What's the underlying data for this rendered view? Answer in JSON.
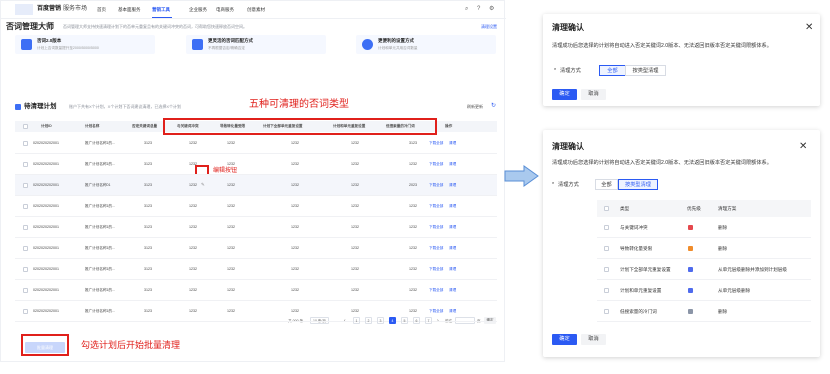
{
  "header": {
    "brand": "百度营销",
    "brand_sub": "服务市场",
    "nav": [
      "首页",
      "基本面服务",
      "营销工具",
      "企业服务",
      "电商服务",
      "创意素材"
    ],
    "active_nav": "营销工具"
  },
  "page": {
    "title": "否词管理大师",
    "subtitle": "否词管理大师支持快速清理计划下的否单元重复且有的关键词冲突的否词，可帮助您快速释放否词空间。",
    "help_link": "清理设置",
    "cards": [
      {
        "title": "否词2.0版本",
        "desc": "计划上否词数量提升至2000/5000/5000"
      },
      {
        "title": "更灵活的否词匹配方式",
        "desc": "不再根据否定/精确否定"
      },
      {
        "title": "更便利的设置方式",
        "desc": "计划和单元共用否词数量"
      }
    ]
  },
  "plans": {
    "title": "待清理计划",
    "summary": "账户下共有X个计划，X个计划下否词建议清理，已选择X个计划",
    "refresh": "刷新更新",
    "columns": [
      "计划ID",
      "计划名称",
      "否定关键词总量",
      "与关键词冲突",
      "导致转化量受限",
      "计划下全部单元重复设置",
      "计划和单元重复设置",
      "低搜索量的冷门词",
      "操作"
    ],
    "rows": [
      {
        "id": "0202020202001",
        "name": "推广计划名称1的...",
        "total": "3123",
        "c1": "1232",
        "c2": "1232",
        "c3": "1232",
        "c4": "1232",
        "c5": "3123"
      },
      {
        "id": "0202020202001",
        "name": "推广计划名称1的...",
        "total": "3123",
        "c1": "1232",
        "c2": "1232",
        "c3": "1232",
        "c4": "1232",
        "c5": "1232"
      },
      {
        "id": "0202020202001",
        "name": "推广计划名称01",
        "total": "3123",
        "c1": "1232",
        "c2": "1232",
        "c3": "1232",
        "c4": "1232",
        "c5": "2023"
      },
      {
        "id": "0202020202001",
        "name": "推广计划名称1的...",
        "total": "3123",
        "c1": "1232",
        "c2": "1232",
        "c3": "1232",
        "c4": "1232",
        "c5": "1232"
      },
      {
        "id": "0202020202001",
        "name": "推广计划名称1的...",
        "total": "3123",
        "c1": "1232",
        "c2": "1232",
        "c3": "1232",
        "c4": "1232",
        "c5": "1232"
      },
      {
        "id": "0202020202001",
        "name": "推广计划名称1的...",
        "total": "3123",
        "c1": "1232",
        "c2": "1232",
        "c3": "1232",
        "c4": "1232",
        "c5": "1232"
      },
      {
        "id": "0202020202001",
        "name": "推广计划名称1的...",
        "total": "3123",
        "c1": "1232",
        "c2": "1232",
        "c3": "1232",
        "c4": "1232",
        "c5": "1232"
      },
      {
        "id": "0202020202001",
        "name": "推广计划名称1的...",
        "total": "3123",
        "c1": "1232",
        "c2": "1232",
        "c3": "1232",
        "c4": "1232",
        "c5": "1232"
      },
      {
        "id": "0202020202001",
        "name": "推广计划名称1的...",
        "total": "3123",
        "c1": "1232",
        "c2": "1232",
        "c3": "1232",
        "c4": "1232",
        "c5": "1232"
      }
    ],
    "op_download": "下载全部",
    "op_clean": "清理",
    "pagination": {
      "total": "共 000 条",
      "per_page": "10 条/页",
      "pages": [
        "1",
        "2",
        "3",
        "4",
        "5",
        "6",
        "7"
      ],
      "current": "4",
      "jump_label": "前往",
      "jump_unit": "页",
      "confirm": "确定"
    },
    "batch_button": "批量清理"
  },
  "annotations": {
    "types": "五种可清理的否词类型",
    "edit": "编辑按钮",
    "batch": "勾选计划后开始批量清理"
  },
  "dialog1": {
    "title": "清理确认",
    "desc": "清理成功后您选择的计划将自动进入否定关键词2.0版本、无法返回旧版本否定关键词限额体系。",
    "required_mark": "*",
    "method_label": "清理方式",
    "options": [
      "全部",
      "按类型清理"
    ],
    "selected": "全部",
    "ok": "确定",
    "cancel": "取消"
  },
  "dialog2": {
    "title": "清理确认",
    "desc": "清理成功后您选择的计划将自动进入否定关键词2.0版本、无法返回旧版本否定关键词限额体系。",
    "required_mark": "*",
    "method_label": "清理方式",
    "options": [
      "全部",
      "按类型清理"
    ],
    "selected": "按类型清理",
    "columns": [
      "类型",
      "优先级",
      "清理方案"
    ],
    "rows": [
      {
        "type": "与关键词冲突",
        "priority_color": "#e5484d",
        "plan": "删除"
      },
      {
        "type": "导致转化量受限",
        "priority_color": "#f08c2b",
        "plan": "删除"
      },
      {
        "type": "计划下全部单元重复设置",
        "priority_color": "#4f6bed",
        "plan": "从单元层级删除并添加到计划层级"
      },
      {
        "type": "计划和单元重复设置",
        "priority_color": "#4f6bed",
        "plan": "从单元层级删除"
      },
      {
        "type": "低搜索量的冷门词",
        "priority_color": "#8b95a7",
        "plan": "删除"
      }
    ],
    "ok": "确定",
    "cancel": "取消"
  },
  "colors": {
    "accent": "#2b5af3",
    "annotation_red": "#e0201b"
  }
}
